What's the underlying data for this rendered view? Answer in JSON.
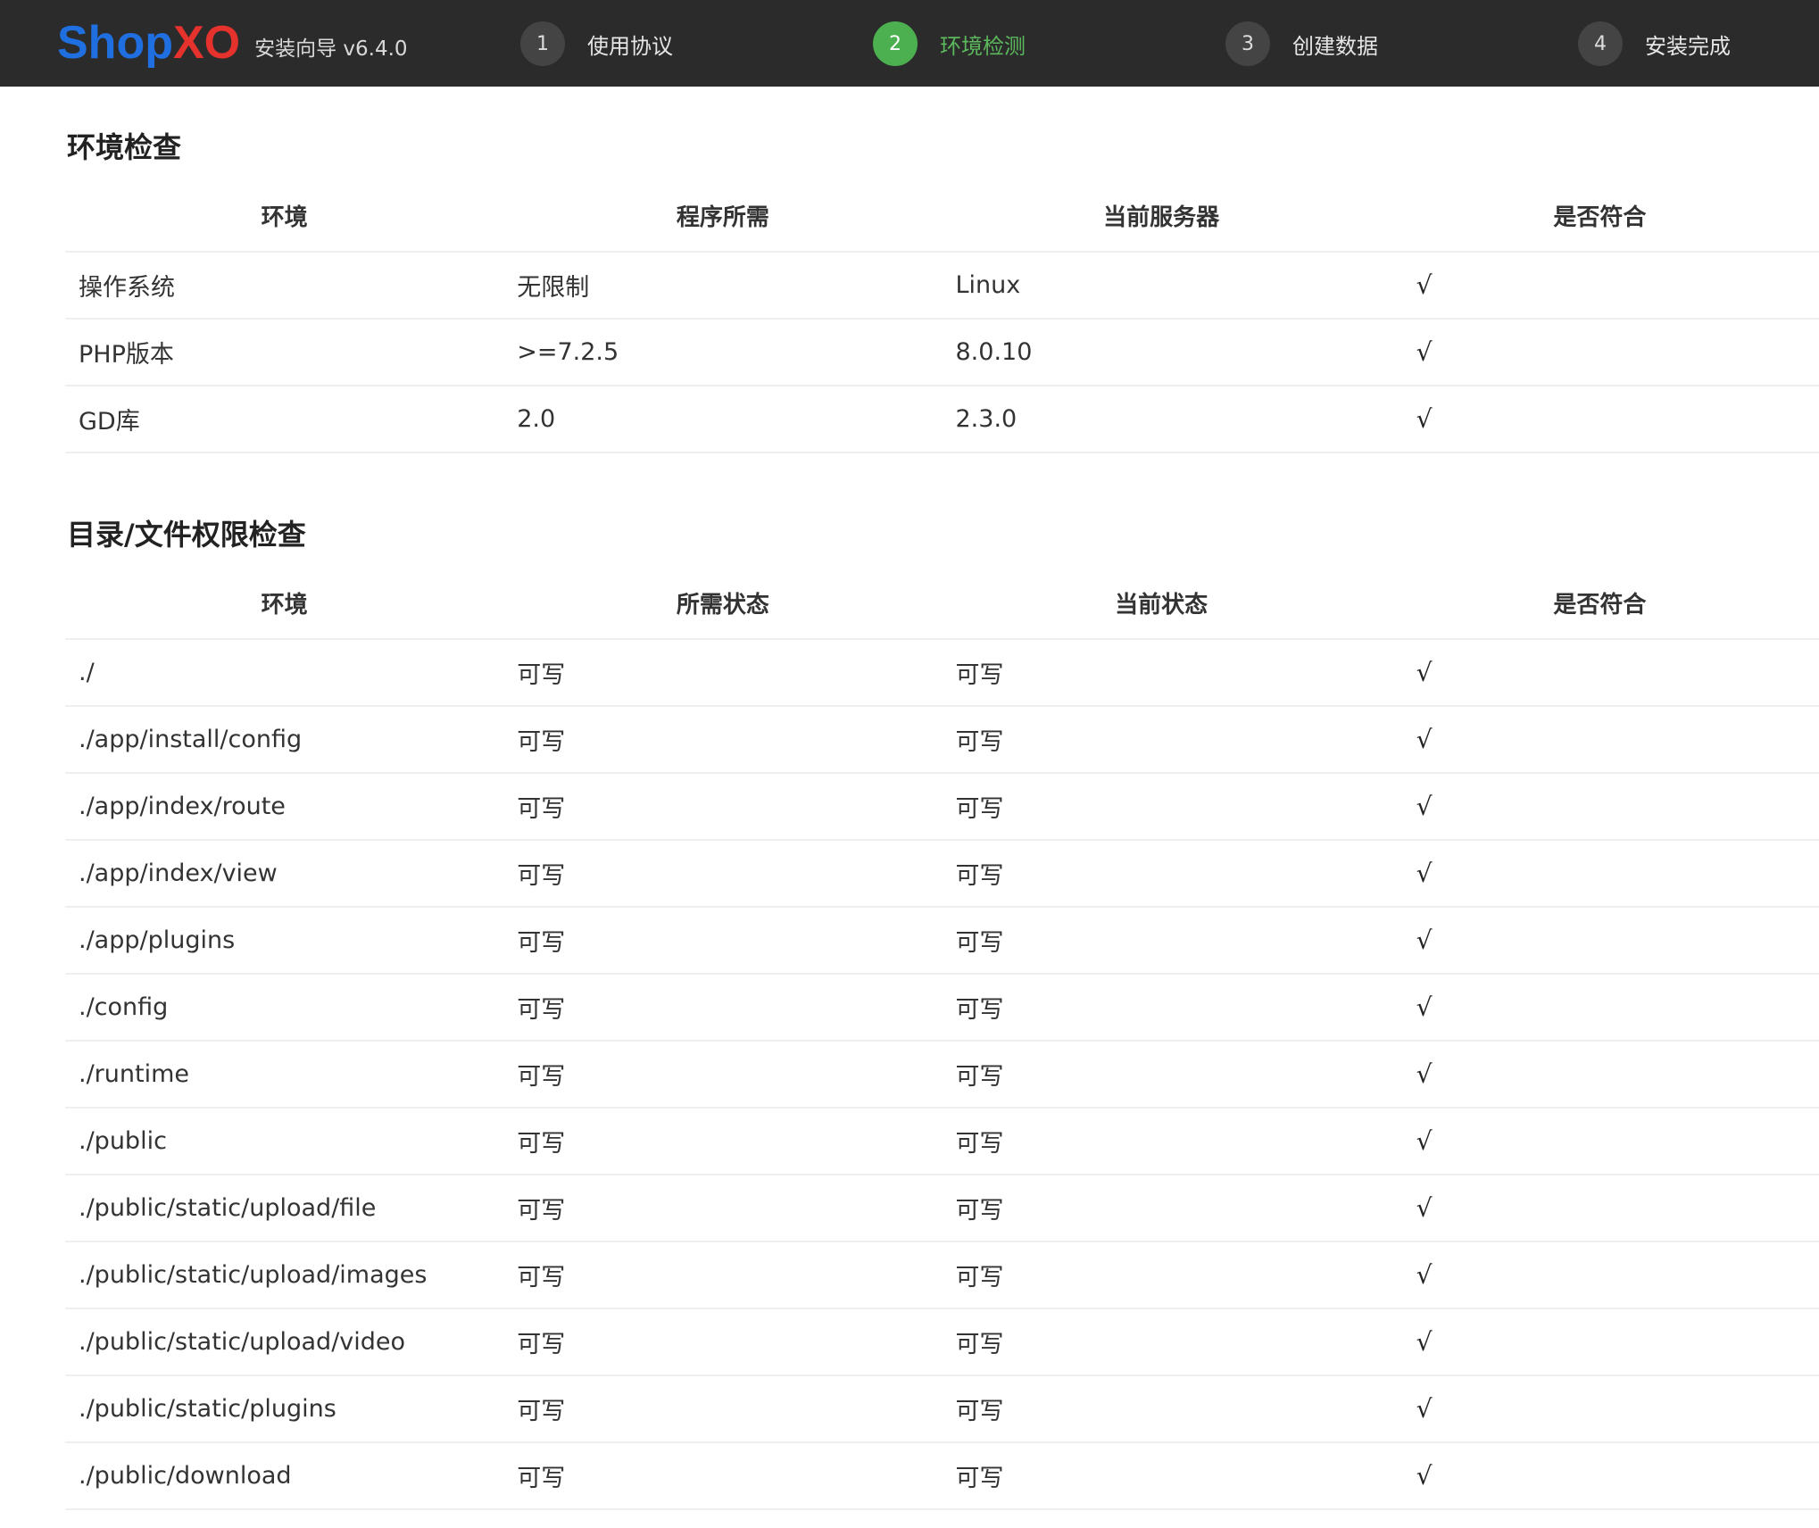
{
  "header": {
    "logo_shop": "Shop",
    "logo_xo": "XO",
    "subtitle": "安装向导 v6.4.0",
    "steps": [
      {
        "num": "1",
        "label": "使用协议",
        "active": false
      },
      {
        "num": "2",
        "label": "环境检测",
        "active": true
      },
      {
        "num": "3",
        "label": "创建数据",
        "active": false
      },
      {
        "num": "4",
        "label": "安装完成",
        "active": false
      }
    ]
  },
  "env_check": {
    "title": "环境检查",
    "columns": [
      "环境",
      "程序所需",
      "当前服务器",
      "是否符合"
    ],
    "rows": [
      [
        "操作系统",
        "无限制",
        "Linux",
        "√"
      ],
      [
        "PHP版本",
        ">=7.2.5",
        "8.0.10",
        "√"
      ],
      [
        "GD库",
        "2.0",
        "2.3.0",
        "√"
      ]
    ]
  },
  "perm_check": {
    "title": "目录/文件权限检查",
    "columns": [
      "环境",
      "所需状态",
      "当前状态",
      "是否符合"
    ],
    "rows": [
      [
        "./",
        "可写",
        "可写",
        "√"
      ],
      [
        "./app/install/config",
        "可写",
        "可写",
        "√"
      ],
      [
        "./app/index/route",
        "可写",
        "可写",
        "√"
      ],
      [
        "./app/index/view",
        "可写",
        "可写",
        "√"
      ],
      [
        "./app/plugins",
        "可写",
        "可写",
        "√"
      ],
      [
        "./config",
        "可写",
        "可写",
        "√"
      ],
      [
        "./runtime",
        "可写",
        "可写",
        "√"
      ],
      [
        "./public",
        "可写",
        "可写",
        "√"
      ],
      [
        "./public/static/upload/file",
        "可写",
        "可写",
        "√"
      ],
      [
        "./public/static/upload/images",
        "可写",
        "可写",
        "√"
      ],
      [
        "./public/static/upload/video",
        "可写",
        "可写",
        "√"
      ],
      [
        "./public/static/plugins",
        "可写",
        "可写",
        "√"
      ],
      [
        "./public/download",
        "可写",
        "可写",
        "√"
      ]
    ]
  }
}
